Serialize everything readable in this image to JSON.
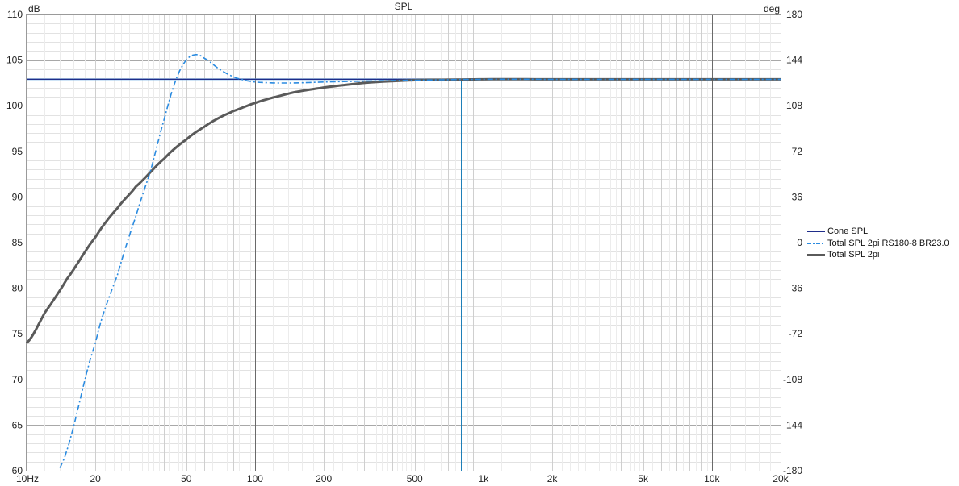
{
  "chart_data": {
    "type": "line",
    "title": "SPL",
    "ylabel": "dB",
    "y2label": "deg",
    "xscale": "log",
    "xlim": [
      10,
      20000
    ],
    "ylim": [
      60,
      110
    ],
    "y2lim": [
      -180,
      180
    ],
    "x_ticks": [
      {
        "value": 10,
        "label": "10Hz"
      },
      {
        "value": 20,
        "label": "20"
      },
      {
        "value": 50,
        "label": "50"
      },
      {
        "value": 100,
        "label": "100"
      },
      {
        "value": 200,
        "label": "200"
      },
      {
        "value": 500,
        "label": "500"
      },
      {
        "value": 1000,
        "label": "1k"
      },
      {
        "value": 2000,
        "label": "2k"
      },
      {
        "value": 5000,
        "label": "5k"
      },
      {
        "value": 10000,
        "label": "10k"
      },
      {
        "value": 20000,
        "label": "20k"
      }
    ],
    "y_ticks": [
      "110",
      "105",
      "100",
      "95",
      "90",
      "85",
      "80",
      "75",
      "70",
      "65",
      "60"
    ],
    "y2_ticks": [
      "180",
      "144",
      "108",
      "72",
      "36",
      "0",
      "-36",
      "-72",
      "-108",
      "-144",
      "-180"
    ],
    "grid": true,
    "marker_x": 800,
    "legend_position": "right",
    "series": [
      {
        "name": "Cone SPL",
        "color": "#1f2d8a",
        "style": "solid",
        "x": [
          10,
          20000
        ],
        "y": [
          102.9,
          102.9
        ]
      },
      {
        "name": "Total SPL 2pi RS180-8 BR23.0",
        "color": "#2b8be0",
        "style": "dashdot",
        "x": [
          14,
          20,
          25,
          30,
          35,
          40,
          45,
          50,
          55,
          60,
          70,
          80,
          90,
          100,
          120,
          150,
          200,
          300,
          500,
          1000,
          2000,
          5000,
          10000,
          20000
        ],
        "y": [
          60.3,
          74.0,
          81.5,
          87.8,
          93.0,
          98.5,
          102.8,
          105.0,
          105.6,
          105.2,
          104.0,
          103.2,
          102.8,
          102.6,
          102.5,
          102.5,
          102.6,
          102.7,
          102.8,
          102.9,
          102.9,
          102.9,
          102.9,
          102.9
        ]
      },
      {
        "name": "Total SPL 2pi",
        "color": "#5a5a5a",
        "style": "solid-thick",
        "x": [
          10,
          12,
          15,
          20,
          25,
          30,
          40,
          50,
          60,
          70,
          80,
          100,
          120,
          150,
          200,
          300,
          500,
          700,
          1000,
          2000,
          5000,
          10000,
          20000
        ],
        "y": [
          74.0,
          77.3,
          81.0,
          85.6,
          88.8,
          91.1,
          94.2,
          96.3,
          97.7,
          98.7,
          99.4,
          100.3,
          100.9,
          101.5,
          102.0,
          102.5,
          102.8,
          102.85,
          102.9,
          102.9,
          102.9,
          102.9,
          102.9
        ]
      }
    ]
  }
}
